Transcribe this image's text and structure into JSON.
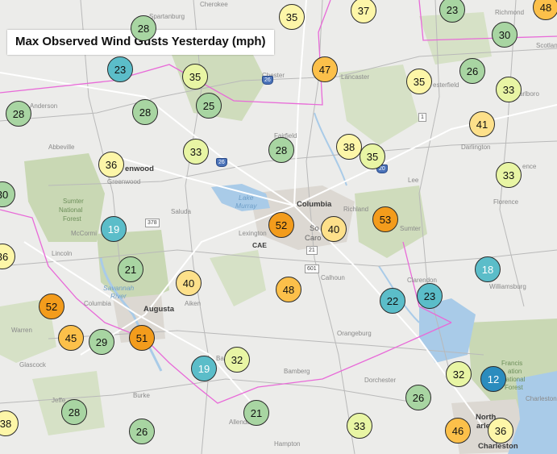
{
  "title": "Max Observed Wind Gusts Yesterday (mph)",
  "colors": {
    "background": "#ececea",
    "forest": "#c9d8b4",
    "urban": "#d9d6d2",
    "water": "#a9cbe8",
    "state_line": "#e86ad8",
    "county_line": "#b8b8b8",
    "road": "#ffffff",
    "gust_le20": "#2b8cbe",
    "gust_20_24": "#5bbdc9",
    "gust_25_29": "#a8d5a2",
    "gust_30_34": "#e8f5a4",
    "gust_35_39": "#fdf6a8",
    "gust_40_44": "#fde08a",
    "gust_45_49": "#fcc04a",
    "gust_50plus": "#f39c1c"
  },
  "places": [
    {
      "id": "spartanburg",
      "label": "Spartanburg"
    },
    {
      "id": "cherokee",
      "label": "Cherokee"
    },
    {
      "id": "richmond",
      "label": "Richmond"
    },
    {
      "id": "scotland",
      "label": "Scotlan"
    },
    {
      "id": "chester",
      "label": "Chester"
    },
    {
      "id": "lancaster",
      "label": "Lancaster"
    },
    {
      "id": "chesterfield",
      "label": "esterfield"
    },
    {
      "id": "marlboro",
      "label": "arlboro"
    },
    {
      "id": "anderson",
      "label": "Anderson"
    },
    {
      "id": "fairfield",
      "label": "Fairfield"
    },
    {
      "id": "darlington",
      "label": "Darlington"
    },
    {
      "id": "florence",
      "label": "ence"
    },
    {
      "id": "florence2",
      "label": "Florence"
    },
    {
      "id": "abbeville",
      "label": "Abbeville"
    },
    {
      "id": "greenwood",
      "label": "Greenwood"
    },
    {
      "id": "greenwood2",
      "label": "enwood"
    },
    {
      "id": "lee",
      "label": "Lee"
    },
    {
      "id": "columbia",
      "label": "Columbia"
    },
    {
      "id": "richland",
      "label": "Richland"
    },
    {
      "id": "lakemurray1",
      "label": "Lake"
    },
    {
      "id": "lakemurray2",
      "label": "Murray"
    },
    {
      "id": "sumter_nf1",
      "label": "Sumter"
    },
    {
      "id": "sumter_nf2",
      "label": "National"
    },
    {
      "id": "sumter_nf3",
      "label": "Forest"
    },
    {
      "id": "saluda",
      "label": "Saluda"
    },
    {
      "id": "mccormick",
      "label": "McCormi"
    },
    {
      "id": "lexington",
      "label": "Lexington"
    },
    {
      "id": "cae",
      "label": "CAE"
    },
    {
      "id": "southcarolina1",
      "label": "So"
    },
    {
      "id": "southcarolina2",
      "label": "Caro"
    },
    {
      "id": "sumter",
      "label": "Sumter"
    },
    {
      "id": "lincoln",
      "label": "Lincoln"
    },
    {
      "id": "calhoun",
      "label": "Calhoun"
    },
    {
      "id": "clarendon",
      "label": "Clarendon"
    },
    {
      "id": "williamsburg",
      "label": "Williamsburg"
    },
    {
      "id": "savannah1",
      "label": "Savannah"
    },
    {
      "id": "savannah2",
      "label": "River"
    },
    {
      "id": "columbia_co",
      "label": "Columbia"
    },
    {
      "id": "augusta",
      "label": "Augusta"
    },
    {
      "id": "aiken",
      "label": "Aiken"
    },
    {
      "id": "orangeburg",
      "label": "Orangeburg"
    },
    {
      "id": "warren",
      "label": "Warren"
    },
    {
      "id": "glascock",
      "label": "Glascock"
    },
    {
      "id": "barnwell",
      "label": "Ba"
    },
    {
      "id": "bamberg",
      "label": "Bamberg"
    },
    {
      "id": "dorchester",
      "label": "Dorchester"
    },
    {
      "id": "berkeley",
      "label": "erkel"
    },
    {
      "id": "francis1",
      "label": "Francis"
    },
    {
      "id": "francis2",
      "label": "ation"
    },
    {
      "id": "francis3",
      "label": "National"
    },
    {
      "id": "francis4",
      "label": "Forest"
    },
    {
      "id": "burke",
      "label": "Burke"
    },
    {
      "id": "jefferson",
      "label": "Jeffe"
    },
    {
      "id": "allendale",
      "label": "Allenda"
    },
    {
      "id": "charleston_co",
      "label": "Charleston"
    },
    {
      "id": "hampton",
      "label": "Hampton"
    },
    {
      "id": "north_charleston1",
      "label": "North"
    },
    {
      "id": "north_charleston2",
      "label": "arle"
    },
    {
      "id": "charleston",
      "label": "Charleston"
    }
  ],
  "shields": [
    {
      "id": "i26a",
      "label": "26"
    },
    {
      "id": "i26b",
      "label": "26"
    },
    {
      "id": "i20",
      "label": "20"
    },
    {
      "id": "us1",
      "label": "1"
    },
    {
      "id": "us378",
      "label": "378"
    },
    {
      "id": "us601",
      "label": "601"
    },
    {
      "id": "us21",
      "label": "21"
    },
    {
      "id": "i20b",
      "label": "20"
    },
    {
      "id": "us52",
      "label": "52"
    }
  ],
  "gusts": [
    {
      "id": "g01",
      "value": 28
    },
    {
      "id": "g02",
      "value": 35
    },
    {
      "id": "g03",
      "value": 37
    },
    {
      "id": "g04",
      "value": 23
    },
    {
      "id": "g05",
      "value": 48
    },
    {
      "id": "g06",
      "value": 30
    },
    {
      "id": "g07",
      "value": 23
    },
    {
      "id": "g08",
      "value": 35
    },
    {
      "id": "g09",
      "value": 47
    },
    {
      "id": "g10",
      "value": 35
    },
    {
      "id": "g11",
      "value": 26
    },
    {
      "id": "g12",
      "value": 33
    },
    {
      "id": "g13",
      "value": 28
    },
    {
      "id": "g14",
      "value": 28
    },
    {
      "id": "g15",
      "value": 25
    },
    {
      "id": "g16",
      "value": 41
    },
    {
      "id": "g17",
      "value": 33
    },
    {
      "id": "g18",
      "value": 28
    },
    {
      "id": "g19",
      "value": 38
    },
    {
      "id": "g20",
      "value": 35
    },
    {
      "id": "g21",
      "value": 36
    },
    {
      "id": "g22",
      "value": 33
    },
    {
      "id": "g23",
      "value": 30
    },
    {
      "id": "g24",
      "value": 52
    },
    {
      "id": "g25",
      "value": 40
    },
    {
      "id": "g26",
      "value": 53
    },
    {
      "id": "g27",
      "value": 19
    },
    {
      "id": "g28",
      "value": 36
    },
    {
      "id": "g29",
      "value": 21
    },
    {
      "id": "g30",
      "value": 18
    },
    {
      "id": "g31",
      "value": 40
    },
    {
      "id": "g32",
      "value": 48
    },
    {
      "id": "g33",
      "value": 22
    },
    {
      "id": "g34",
      "value": 23
    },
    {
      "id": "g35",
      "value": 52
    },
    {
      "id": "g36",
      "value": 45
    },
    {
      "id": "g37",
      "value": 29
    },
    {
      "id": "g38",
      "value": 51
    },
    {
      "id": "g39",
      "value": 19
    },
    {
      "id": "g40",
      "value": 32
    },
    {
      "id": "g41",
      "value": 32
    },
    {
      "id": "g42",
      "value": 12
    },
    {
      "id": "g43",
      "value": 26
    },
    {
      "id": "g44",
      "value": 28
    },
    {
      "id": "g45",
      "value": 38
    },
    {
      "id": "g46",
      "value": 26
    },
    {
      "id": "g47",
      "value": 21
    },
    {
      "id": "g48",
      "value": 33
    },
    {
      "id": "g49",
      "value": 46
    },
    {
      "id": "g50",
      "value": 36
    }
  ]
}
